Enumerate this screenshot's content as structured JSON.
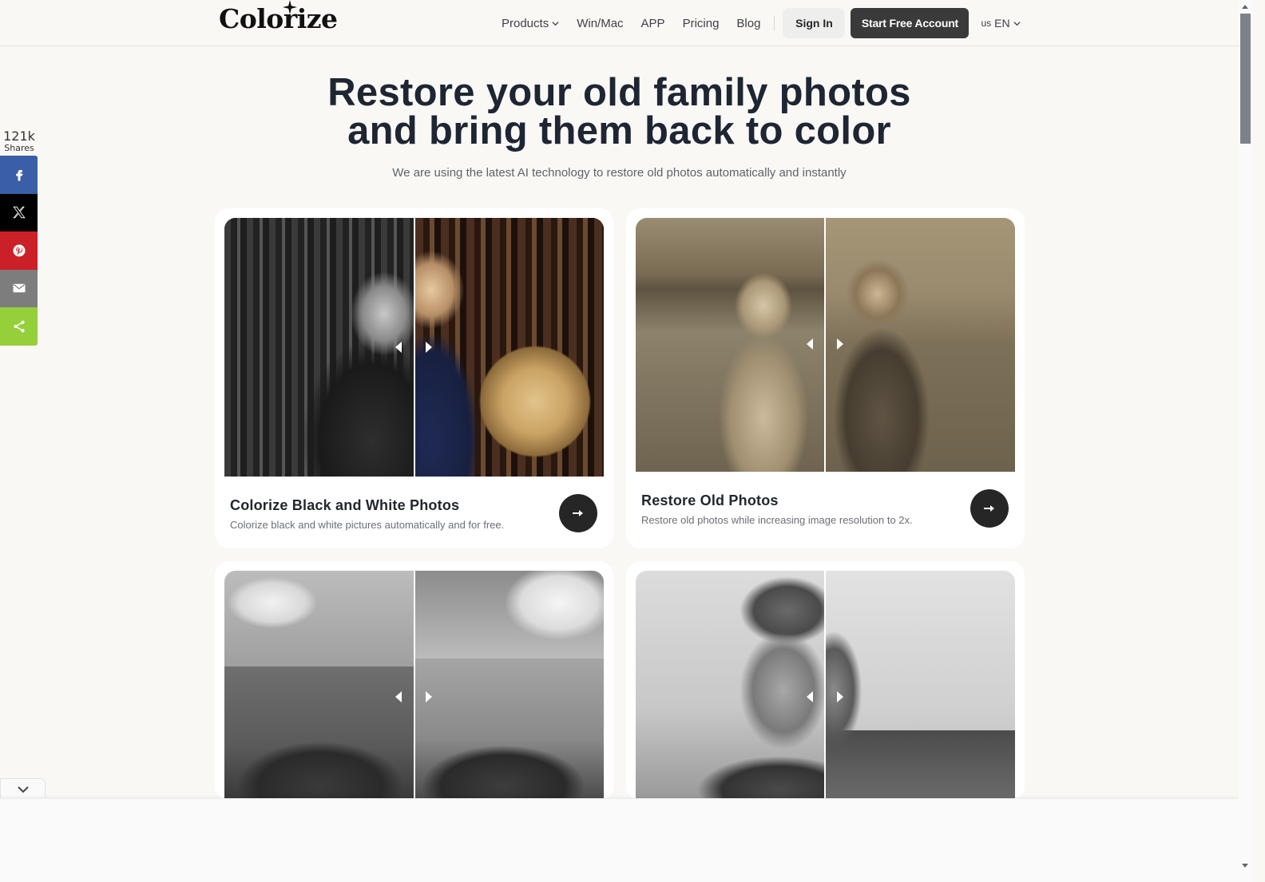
{
  "header": {
    "logo": "Colorize",
    "nav": [
      {
        "label": "Products",
        "has_dropdown": true
      },
      {
        "label": "Win/Mac",
        "has_dropdown": false
      },
      {
        "label": "APP",
        "has_dropdown": false
      },
      {
        "label": "Pricing",
        "has_dropdown": false
      },
      {
        "label": "Blog",
        "has_dropdown": false
      }
    ],
    "sign_in": "Sign In",
    "start_free": "Start Free Account",
    "lang_flag": "us",
    "lang_label": "EN"
  },
  "hero": {
    "title_line1": "Restore your old family photos",
    "title_line2": "and bring them back to color",
    "subtitle": "We are using the latest AI technology to restore old photos automatically and instantly"
  },
  "share": {
    "count": "121k",
    "label": "Shares",
    "buttons": [
      {
        "name": "facebook",
        "icon": "facebook-icon",
        "color": "#3b5ea8"
      },
      {
        "name": "x",
        "icon": "x-icon",
        "color": "#000000"
      },
      {
        "name": "pinterest",
        "icon": "pinterest-icon",
        "color": "#cb2027"
      },
      {
        "name": "email",
        "icon": "mail-icon",
        "color": "#7d7d7d"
      },
      {
        "name": "more",
        "icon": "share-icon",
        "color": "#95d03a"
      }
    ]
  },
  "cards": [
    {
      "title": "Colorize Black and White Photos",
      "description": "Colorize black and white pictures automatically and for free.",
      "image_before": "Black and white portrait of elderly man with white hair in study with bookshelves",
      "image_after": "Colorized portrait of the same man beside a globe"
    },
    {
      "title": "Restore Old Photos",
      "description": "Restore old photos while increasing image resolution to 2x.",
      "image_before": "Sepia photo of young girl in a field",
      "image_after": "Restored sharper sepia photo of the girl"
    },
    {
      "title": "",
      "description": "",
      "image_before": "Black and white photo of a castle on a hill",
      "image_after": "Enhanced black and white castle photo"
    },
    {
      "title": "",
      "description": "",
      "image_before": "Blurry black and white portrait of young man outdoors",
      "image_after": "Sharpened black and white portrait of young man"
    }
  ],
  "colors": {
    "background": "#f9f8f5",
    "primary_button": "#3a3a3a",
    "heading": "#1e2533",
    "card_arrow": "#262626"
  }
}
